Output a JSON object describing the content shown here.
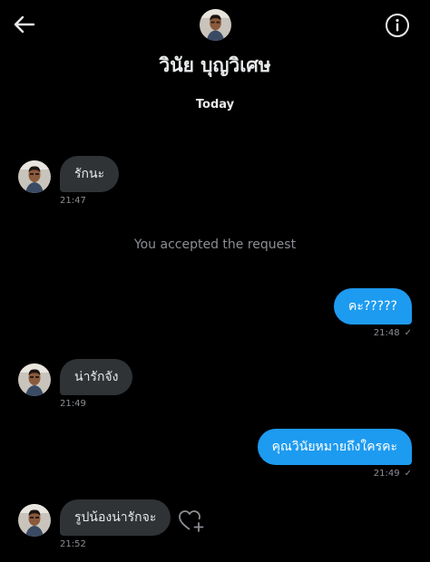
{
  "header": {
    "contact_name": "วินัย บุญวิเศษ",
    "back_icon": "arrow-left-icon",
    "info_icon": "info-icon"
  },
  "date_separator": "Today",
  "system_note": "You accepted the request",
  "messages": [
    {
      "direction": "in",
      "text": "รักนะ",
      "time": "21:47"
    },
    {
      "direction": "out",
      "text": "คะ?????",
      "time": "21:48",
      "status": "✓"
    },
    {
      "direction": "in",
      "text": "น่ารักจัง",
      "time": "21:49"
    },
    {
      "direction": "out",
      "text": "คุณวินัยหมายถึงใครคะ",
      "time": "21:49",
      "status": "✓"
    },
    {
      "direction": "in",
      "text": "รูปน้องน่ารักจะ",
      "time": "21:52"
    }
  ],
  "react_icon": "heart-add-icon",
  "colors": {
    "background": "#000000",
    "incoming_bubble": "#2f3336",
    "outgoing_bubble": "#1d9bf0",
    "secondary_text": "#8b8f94"
  }
}
